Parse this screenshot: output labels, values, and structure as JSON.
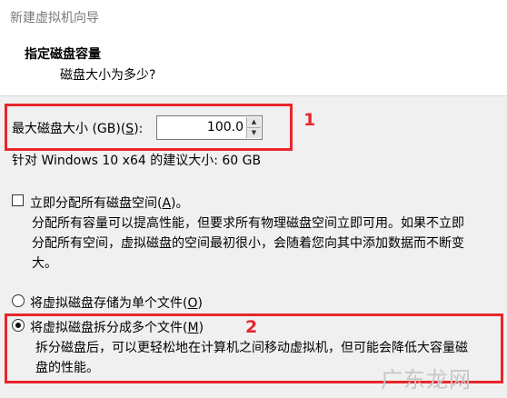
{
  "window": {
    "title": "新建虚拟机向导"
  },
  "header": {
    "title": "指定磁盘容量",
    "subtitle": "磁盘大小为多少?"
  },
  "disk_size": {
    "label_prefix": "最大磁盘大小 (GB)(",
    "label_key": "S",
    "label_suffix": "):",
    "value": "100.0",
    "up_glyph": "▲",
    "down_glyph": "▼"
  },
  "recommend": "针对 Windows 10 x64 的建议大小: 60 GB",
  "allocate": {
    "label_prefix": "立即分配所有磁盘空间(",
    "label_key": "A",
    "label_suffix": ")。",
    "checked": false,
    "desc_line1": "分配所有容量可以提高性能，但要求所有物理磁盘空间立即可用。如果不立即",
    "desc_line2": "分配所有空间，虚拟磁盘的空间最初很小，会随着您向其中添加数据而不断变",
    "desc_line3": "大。"
  },
  "single_file": {
    "label_prefix": "将虚拟磁盘存储为单个文件(",
    "label_key": "O",
    "label_suffix": ")",
    "checked": false
  },
  "multi_file": {
    "label_prefix": "将虚拟磁盘拆分成多个文件(",
    "label_key": "M",
    "label_suffix": ")",
    "checked": true,
    "desc_line1": "拆分磁盘后，可以更轻松地在计算机之间移动虚拟机，但可能会降低大容量磁",
    "desc_line2": "盘的性能。"
  },
  "annotations": {
    "one": "1",
    "two": "2",
    "color": "#e8262b"
  },
  "watermark": "广东龙网"
}
